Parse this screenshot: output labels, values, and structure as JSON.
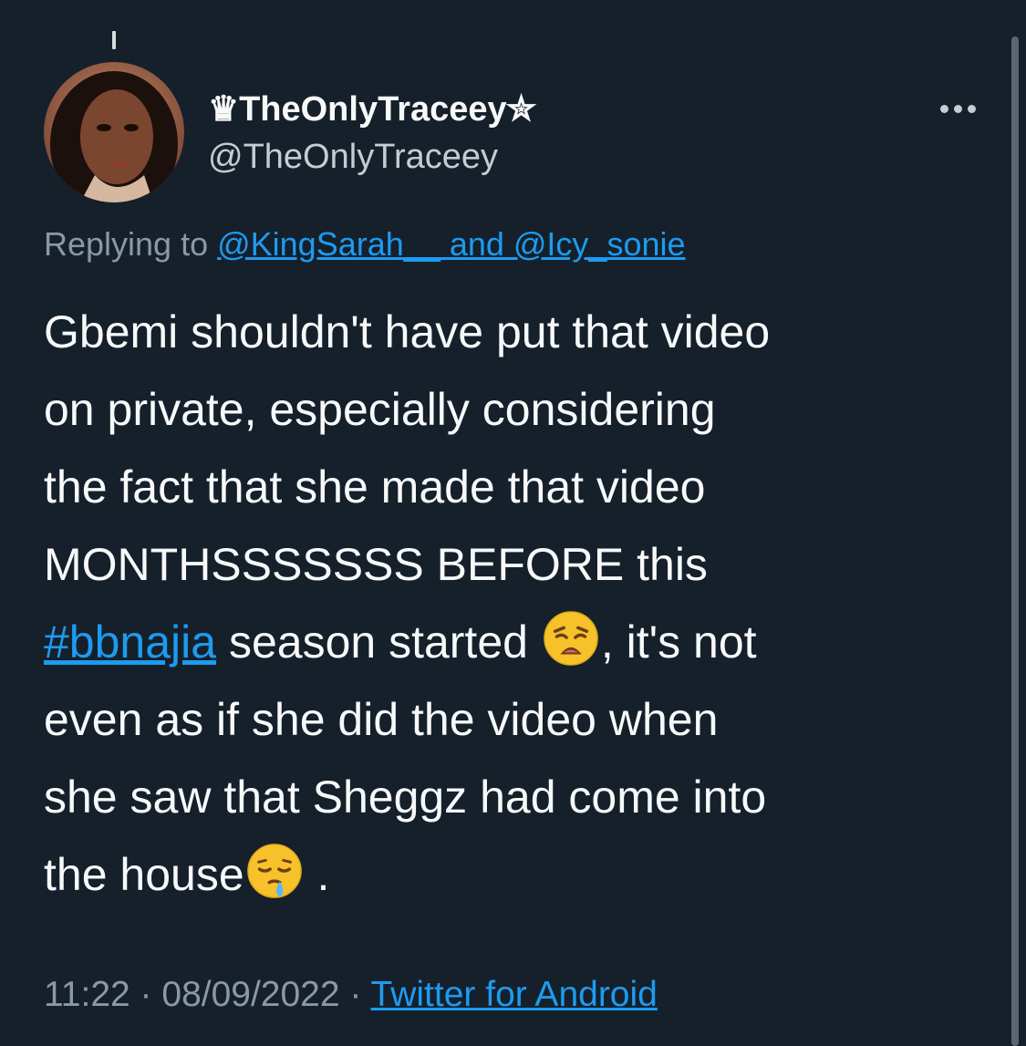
{
  "tweet": {
    "display_name": "♛TheOnlyTraceey✮",
    "handle": "@TheOnlyTraceey",
    "more_icon": "more-horizontal-icon",
    "replying_prefix": "Replying to ",
    "replying_mentions": "@KingSarah__ and @Icy_sonie",
    "body_lines": [
      "Gbemi shouldn't have put that video",
      "on private, especially considering",
      "the fact that she made that video",
      "MONTHSSSSSSS BEFORE this"
    ],
    "hashtag": "#bbnajia",
    "line5_after_hashtag": " season started ",
    "line5_emoji": "weary-face-emoji",
    "line5_tail": ", it's not",
    "line6": "even as if she did the video when",
    "line7": "she saw that Sheggz had come into",
    "line8_text": "the house",
    "line8_emoji": "sleepy-face-emoji",
    "line8_tail": " .",
    "time": "11:22",
    "separator": " · ",
    "date": "08/09/2022",
    "source": "Twitter for Android"
  },
  "colors": {
    "background": "#15202b",
    "text": "#f7f9f9",
    "muted": "#8b98a5",
    "link": "#1d9bf0"
  }
}
